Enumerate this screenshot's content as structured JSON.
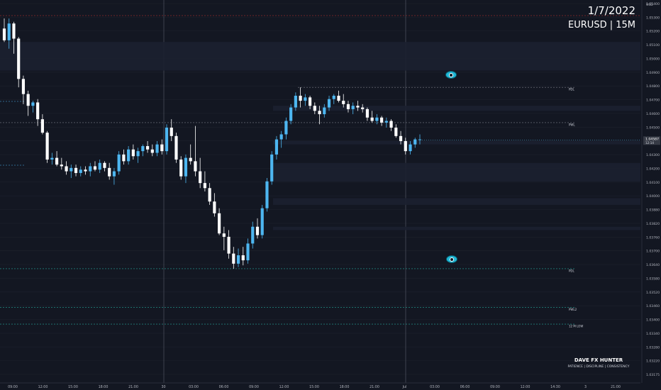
{
  "watermark": {
    "date": "1/7/2022",
    "symbol_line": "EURUSD | 15M"
  },
  "branding": {
    "name": "DAVE FX HUNTER",
    "tagline": "PATIENCE | DISCIPLINE | CONSISTENCY"
  },
  "icons": {
    "marker": "eye-icon"
  },
  "colors": {
    "background": "#131722",
    "grid": "#1e222d",
    "bull": "#4db6f0",
    "bear": "#ffffff",
    "zone": "#1c2030",
    "demand_zone": "#3e3852",
    "level": "#5a6270",
    "price_label": "#363a45"
  },
  "chart_data": {
    "type": "candlestick",
    "symbol": "EURUSD",
    "timeframe": "15M",
    "yaxis": {
      "unit": "USD",
      "ylim": [
        1.0314,
        1.0542
      ],
      "ticks": [
        "1.05400",
        "1.05300",
        "1.05200",
        "1.05100",
        "1.05000",
        "1.04900",
        "1.04800",
        "1.04700",
        "1.04600",
        "1.04500",
        "1.04400",
        "1.04300",
        "1.04200",
        "1.04100",
        "1.04000",
        "1.03880",
        "1.03820",
        "1.03760",
        "1.03700",
        "1.03640",
        "1.03580",
        "1.03520",
        "1.03460",
        "1.03400",
        "1.03340",
        "1.03280",
        "1.03220",
        "1.03175"
      ]
    },
    "xaxis": {
      "ticks": [
        "09:00",
        "12:00",
        "15:00",
        "18:00",
        "21:00",
        "30",
        "03:00",
        "06:00",
        "09:00",
        "12:00",
        "15:00",
        "18:00",
        "21:00",
        "Jul",
        "03:00",
        "06:00",
        "09:00",
        "12:00",
        "14:30",
        "3",
        "21:00"
      ]
    },
    "current_price": {
      "value": "1.04587",
      "countdown": "12:14"
    },
    "levels": [
      {
        "label": "PDL",
        "price": 1.049
      },
      {
        "label": "PWL",
        "price": 1.0469
      },
      {
        "label": "PDL",
        "price": 1.0382
      },
      {
        "label": "PWL2",
        "price": 1.0359
      },
      {
        "label": "12 M LOW",
        "price": 1.0349
      }
    ],
    "zones": [
      {
        "kind": "supply",
        "from": 1.05,
        "to": 1.0517
      },
      {
        "kind": "range",
        "from": 1.0476,
        "to": 1.0479
      },
      {
        "kind": "range",
        "from": 1.0456,
        "to": 1.0458
      },
      {
        "kind": "range",
        "from": 1.0434,
        "to": 1.0445
      },
      {
        "kind": "range",
        "from": 1.042,
        "to": 1.0424
      },
      {
        "kind": "range",
        "from": 1.0405,
        "to": 1.0407
      },
      {
        "kind": "demand",
        "from": 1.0384,
        "to": 1.04
      }
    ],
    "candles": [
      [
        1.0525,
        1.0531,
        1.0517,
        1.0518
      ],
      [
        1.0518,
        1.0531,
        1.0513,
        1.0528
      ],
      [
        1.0528,
        1.0529,
        1.051,
        1.0519
      ],
      [
        1.0519,
        1.052,
        1.049,
        1.0495
      ],
      [
        1.0495,
        1.0497,
        1.048,
        1.0486
      ],
      [
        1.0486,
        1.0488,
        1.0473,
        1.0479
      ],
      [
        1.0479,
        1.0482,
        1.0475,
        1.0481
      ],
      [
        1.0481,
        1.0483,
        1.0467,
        1.0471
      ],
      [
        1.0471,
        1.0474,
        1.0462,
        1.0463
      ],
      [
        1.0463,
        1.0464,
        1.0445,
        1.0447
      ],
      [
        1.0447,
        1.0451,
        1.0444,
        1.0448
      ],
      [
        1.0448,
        1.0452,
        1.0443,
        1.0444
      ],
      [
        1.0444,
        1.0448,
        1.0441,
        1.0443
      ],
      [
        1.0443,
        1.0446,
        1.0438,
        1.044
      ],
      [
        1.044,
        1.0444,
        1.0436,
        1.0442
      ],
      [
        1.0442,
        1.0444,
        1.0437,
        1.0439
      ],
      [
        1.0439,
        1.0443,
        1.0437,
        1.0441
      ],
      [
        1.0441,
        1.0443,
        1.0438,
        1.044
      ],
      [
        1.044,
        1.0445,
        1.0437,
        1.0443
      ],
      [
        1.0443,
        1.0446,
        1.044,
        1.0441
      ],
      [
        1.0441,
        1.0447,
        1.0439,
        1.0445
      ],
      [
        1.0445,
        1.0446,
        1.044,
        1.0442
      ],
      [
        1.0442,
        1.0445,
        1.0435,
        1.0437
      ],
      [
        1.0437,
        1.0442,
        1.0432,
        1.044
      ],
      [
        1.044,
        1.0452,
        1.0438,
        1.045
      ],
      [
        1.045,
        1.0453,
        1.0444,
        1.0446
      ],
      [
        1.0446,
        1.0455,
        1.0444,
        1.0453
      ],
      [
        1.0453,
        1.0456,
        1.0447,
        1.0449
      ],
      [
        1.0449,
        1.0454,
        1.0445,
        1.0452
      ],
      [
        1.0452,
        1.0456,
        1.0449,
        1.0455
      ],
      [
        1.0455,
        1.0458,
        1.0451,
        1.0453
      ],
      [
        1.0453,
        1.0456,
        1.0449,
        1.0451
      ],
      [
        1.0451,
        1.0458,
        1.0449,
        1.0456
      ],
      [
        1.0456,
        1.0459,
        1.045,
        1.0452
      ],
      [
        1.0452,
        1.0468,
        1.045,
        1.0466
      ],
      [
        1.0466,
        1.0471,
        1.0458,
        1.0461
      ],
      [
        1.0461,
        1.0463,
        1.0445,
        1.0447
      ],
      [
        1.0447,
        1.0449,
        1.0435,
        1.0437
      ],
      [
        1.0437,
        1.045,
        1.0433,
        1.0448
      ],
      [
        1.0448,
        1.0456,
        1.0444,
        1.0446
      ],
      [
        1.0446,
        1.0467,
        1.0437,
        1.044
      ],
      [
        1.044,
        1.0448,
        1.043,
        1.0433
      ],
      [
        1.0433,
        1.044,
        1.0428,
        1.043
      ],
      [
        1.043,
        1.0433,
        1.042,
        1.0422
      ],
      [
        1.0422,
        1.0427,
        1.0413,
        1.0415
      ],
      [
        1.0415,
        1.0418,
        1.0402,
        1.0403
      ],
      [
        1.0403,
        1.0407,
        1.0393,
        1.0401
      ],
      [
        1.0401,
        1.0405,
        1.0388,
        1.0391
      ],
      [
        1.0391,
        1.0395,
        1.0382,
        1.0385
      ],
      [
        1.0385,
        1.0394,
        1.0383,
        1.039
      ],
      [
        1.039,
        1.0395,
        1.0384,
        1.0387
      ],
      [
        1.0387,
        1.04,
        1.0385,
        1.0397
      ],
      [
        1.0397,
        1.041,
        1.0394,
        1.0407
      ],
      [
        1.0407,
        1.0412,
        1.04,
        1.0402
      ],
      [
        1.0402,
        1.042,
        1.04,
        1.0418
      ],
      [
        1.0418,
        1.0436,
        1.0416,
        1.0434
      ],
      [
        1.0434,
        1.0452,
        1.0432,
        1.045
      ],
      [
        1.045,
        1.0461,
        1.0447,
        1.0459
      ],
      [
        1.0459,
        1.0464,
        1.0454,
        1.0462
      ],
      [
        1.0462,
        1.0472,
        1.0459,
        1.047
      ],
      [
        1.047,
        1.048,
        1.0468,
        1.0478
      ],
      [
        1.0478,
        1.0487,
        1.0476,
        1.0485
      ],
      [
        1.0485,
        1.049,
        1.0478,
        1.0482
      ],
      [
        1.0482,
        1.0486,
        1.0479,
        1.0484
      ],
      [
        1.0484,
        1.0485,
        1.0477,
        1.0479
      ],
      [
        1.0479,
        1.0481,
        1.0474,
        1.0476
      ],
      [
        1.0476,
        1.0479,
        1.0468,
        1.0474
      ],
      [
        1.0474,
        1.048,
        1.0472,
        1.0478
      ],
      [
        1.0478,
        1.0485,
        1.0476,
        1.0483
      ],
      [
        1.0483,
        1.0486,
        1.048,
        1.0485
      ],
      [
        1.0485,
        1.0488,
        1.0481,
        1.0482
      ],
      [
        1.0482,
        1.0486,
        1.0478,
        1.048
      ],
      [
        1.048,
        1.0482,
        1.0475,
        1.0477
      ],
      [
        1.0477,
        1.0481,
        1.0474,
        1.0479
      ],
      [
        1.0479,
        1.0482,
        1.0476,
        1.0478
      ],
      [
        1.0478,
        1.048,
        1.0475,
        1.0477
      ],
      [
        1.0477,
        1.0478,
        1.047,
        1.0472
      ],
      [
        1.0472,
        1.0476,
        1.0469,
        1.047
      ],
      [
        1.047,
        1.0474,
        1.0468,
        1.0472
      ],
      [
        1.0472,
        1.0473,
        1.0467,
        1.0469
      ],
      [
        1.0469,
        1.0472,
        1.0466,
        1.047
      ],
      [
        1.047,
        1.0471,
        1.0464,
        1.0466
      ],
      [
        1.0466,
        1.0468,
        1.046,
        1.0461
      ],
      [
        1.0461,
        1.0464,
        1.0456,
        1.0458
      ],
      [
        1.0458,
        1.046,
        1.045,
        1.0452
      ],
      [
        1.0452,
        1.0458,
        1.045,
        1.0456
      ],
      [
        1.0456,
        1.046,
        1.0454,
        1.0459
      ],
      [
        1.0459,
        1.0462,
        1.0456,
        1.0459
      ]
    ]
  }
}
